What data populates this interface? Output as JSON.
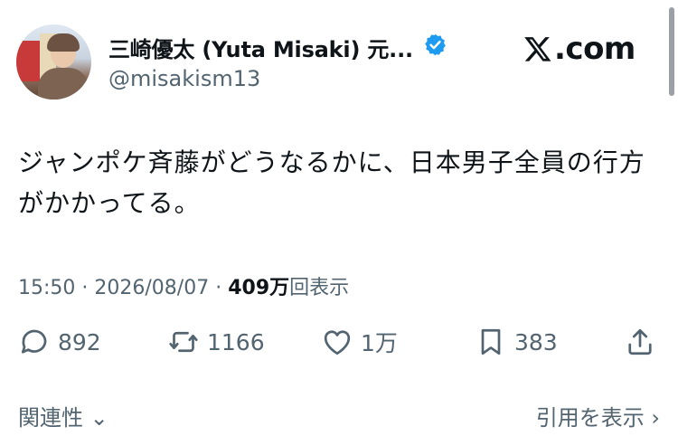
{
  "author": {
    "display_name": "三崎優太 (Yuta Misaki) 元...",
    "handle": "@misakism13",
    "verified": true
  },
  "brand": {
    "logo_icon": "x-logo-icon",
    "domain_text": ".com"
  },
  "tweet": {
    "text": "ジャンポケ斉藤がどうなるかに、日本男子全員の行方がかかってる。",
    "time": "15:50",
    "separator": "·",
    "date": "2026/08/07",
    "views_count": "409万",
    "views_label": "回表示"
  },
  "actions": {
    "replies": {
      "icon": "reply-icon",
      "count": "892"
    },
    "reposts": {
      "icon": "repost-icon",
      "count": "1166"
    },
    "likes": {
      "icon": "heart-icon",
      "count": "1万"
    },
    "bookmarks": {
      "icon": "bookmark-icon",
      "count": "383"
    },
    "share": {
      "icon": "share-icon"
    }
  },
  "footer": {
    "related_label": "関連性",
    "quotes_label": "引用を表示"
  },
  "colors": {
    "text": "#0f1419",
    "secondary": "#536471",
    "verified_blue": "#1d9bf0"
  }
}
